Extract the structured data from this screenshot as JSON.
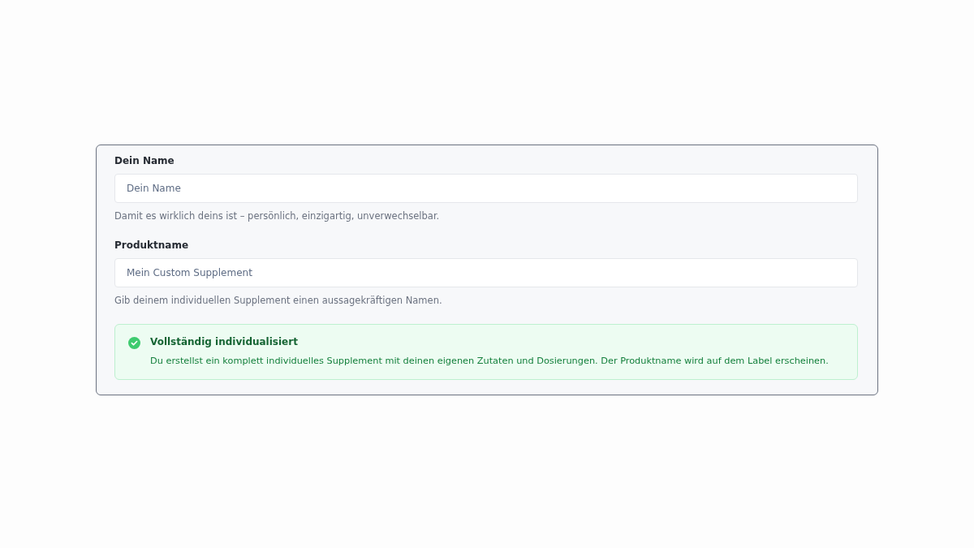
{
  "fields": [
    {
      "label": "Dein Name",
      "placeholder": "Dein Name",
      "hint": "Damit es wirklich deins ist – persönlich, einzigartig, unverwechselbar."
    },
    {
      "label": "Produktname",
      "placeholder": "Mein Custom Supplement",
      "hint": "Gib deinem individuellen Supplement einen aussagekräftigen Namen."
    }
  ],
  "notice": {
    "kind": "success",
    "title": "Vollständig individualisiert",
    "text": "Du erstellst ein komplett individuelles Supplement mit deinen eigenen Zutaten und Dosierungen. Der Produktname wird auf dem Label erscheinen."
  }
}
